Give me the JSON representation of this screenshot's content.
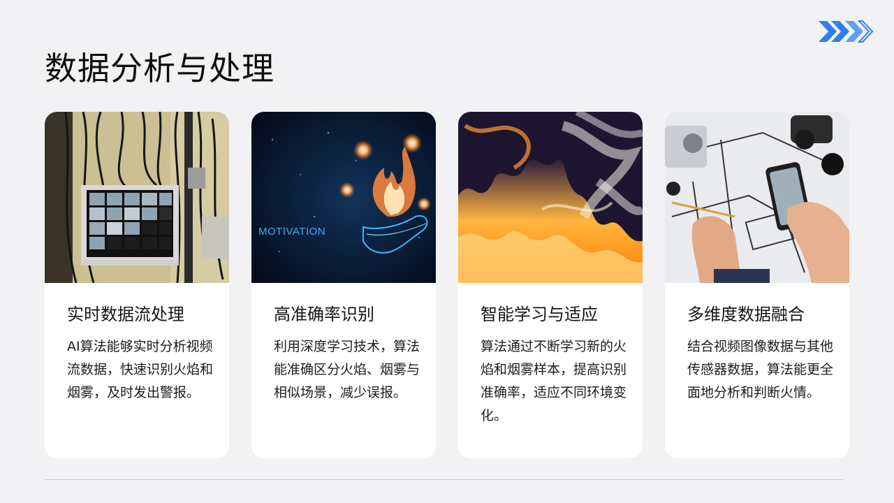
{
  "slide": {
    "title": "数据分析与处理",
    "accent_color": "#2f80ed"
  },
  "cards": [
    {
      "title": "实时数据流处理",
      "body": "AI算法能够实时分析视频流数据，快速识别火焰和烟雾，及时发出警报。",
      "image": "surveillance-monitor-image"
    },
    {
      "title": "高准确率识别",
      "body": "利用深度学习技术，算法能准确区分火焰、烟雾与相似场景，减少误报。",
      "image": "motivation-flame-hand-image",
      "image_text": "MOTIVATION"
    },
    {
      "title": "智能学习与适应",
      "body": "算法通过不断学习新的火焰和烟雾样本，提高识别准确率，适应不同环境变化。",
      "image": "fire-smoke-image"
    },
    {
      "title": "多维度数据融合",
      "body": "结合视频图像数据与其他传感器数据，算法能更全面地分析和判断火情。",
      "image": "phone-cctv-plan-image"
    }
  ]
}
